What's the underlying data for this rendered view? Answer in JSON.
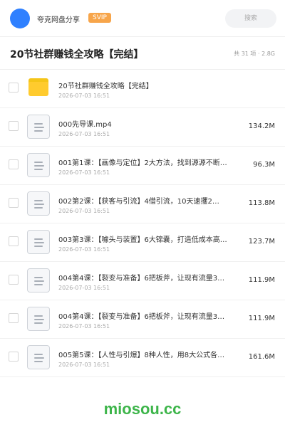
{
  "header": {
    "brand": "夸克网盘分享",
    "badge": "SVIP",
    "search_placeholder": "搜索"
  },
  "folder": {
    "title": "20节社群赚钱全攻略【完结】",
    "summary": "共 31 项 · 2.8G"
  },
  "files": [
    {
      "type": "folder-icon",
      "name": "20节社群赚钱全攻略【完结】",
      "date": "2026-07-03 16:51",
      "size": ""
    },
    {
      "type": "doc-icon",
      "name": "000先导课.mp4",
      "date": "2026-07-03 16:51",
      "size": "134.2M"
    },
    {
      "type": "doc-icon",
      "name": "001第1课：【画像与定位】2大方法，找到源源不断…",
      "date": "2026-07-03 16:51",
      "size": "96.3M"
    },
    {
      "type": "doc-icon",
      "name": "002第2课：【获客与引流】4借引流，10天速攫2…",
      "date": "2026-07-03 16:51",
      "size": "113.8M"
    },
    {
      "type": "doc-icon",
      "name": "003第3课：【噱头与装置】6大锦囊，打造低成本高…",
      "date": "2026-07-03 16:51",
      "size": "123.7M"
    },
    {
      "type": "doc-icon",
      "name": "004第4课：【裂变与准备】6把板斧，让现有流量3…",
      "date": "2026-07-03 16:51",
      "size": "111.9M"
    },
    {
      "type": "doc-icon",
      "name": "004第4课：【裂变与准备】6把板斧，让现有流量3…",
      "date": "2026-07-03 16:51",
      "size": "111.9M"
    },
    {
      "type": "doc-icon",
      "name": "005第5课：【人性与引爆】8种人性，用8大公式各…",
      "date": "2026-07-03 16:51",
      "size": "161.6M"
    }
  ],
  "watermark": "miosou.cc",
  "colors": {
    "accent": "#2f80ff",
    "svip": "#f7a54a",
    "folder": "#ffcb2e",
    "watermark": "#3db54a"
  }
}
